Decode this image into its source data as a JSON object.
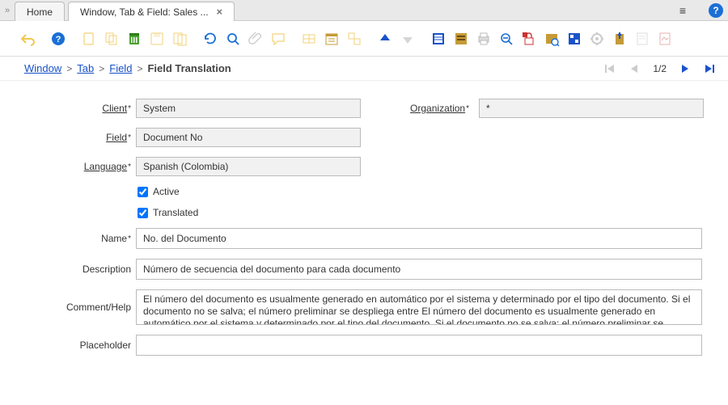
{
  "tabs": {
    "home": "Home",
    "active": "Window, Tab & Field: Sales ..."
  },
  "breadcrumbs": {
    "window": "Window",
    "tab": "Tab",
    "field": "Field",
    "current": "Field Translation",
    "page": "1/2"
  },
  "labels": {
    "client": "Client",
    "organization": "Organization",
    "field": "Field",
    "language": "Language",
    "active": "Active",
    "translated": "Translated",
    "name": "Name",
    "description": "Description",
    "comment_help": "Comment/Help",
    "placeholder": "Placeholder"
  },
  "values": {
    "client": "System",
    "organization": "*",
    "field": "Document No",
    "language": "Spanish (Colombia)",
    "active": true,
    "translated": true,
    "name": "No. del Documento",
    "description": "Número de secuencia del documento para cada documento",
    "comment_help": "El número del documento es usualmente generado en automático por el sistema y determinado por el tipo del documento. Si el documento no se salva; el número preliminar se despliega entre El número del documento es usualmente generado en automático por el sistema y determinado por el tipo del documento. Si el documento no se salva; el número preliminar se",
    "placeholder": ""
  }
}
